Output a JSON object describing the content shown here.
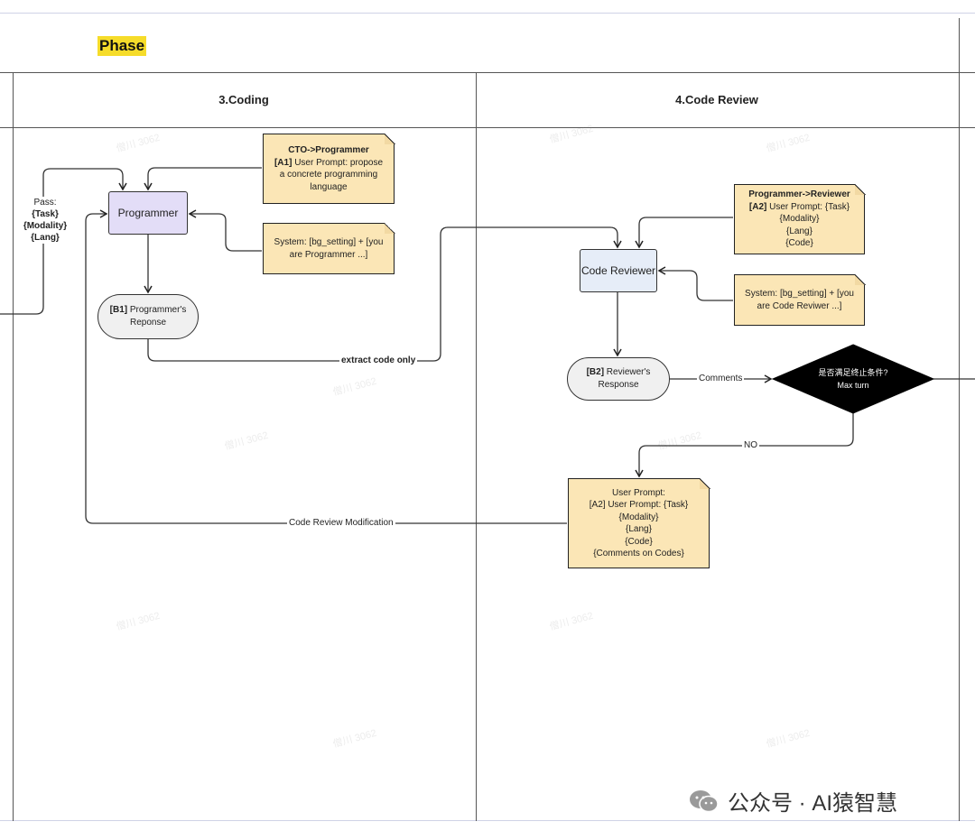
{
  "phase_label": "Phase",
  "columns": [
    {
      "title": "3.Coding"
    },
    {
      "title": "4.Code Review"
    }
  ],
  "pass_note": {
    "line1": "Pass:",
    "line2": "{Task}",
    "line3": "{Modality}",
    "line4": "{Lang}"
  },
  "notes": {
    "cto_programmer": {
      "title": "CTO->Programmer",
      "tag": "[A1]",
      "line1": " User Prompt: propose",
      "line2": "a concrete programming",
      "line3": "language"
    },
    "system_programmer": {
      "line1": "System: [bg_setting] + [you",
      "line2": "are Programmer ...]"
    },
    "programmer_reviewer": {
      "title": "Programmer->Reviewer",
      "tag": "[A2]",
      "line1": " User Prompt: {Task}",
      "line2": "{Modality}",
      "line3": "{Lang}",
      "line4": "{Code}"
    },
    "system_reviewer": {
      "line1": "System: [bg_setting] + [you",
      "line2": "are Code Reviwer ...]"
    },
    "user_prompt_modification": {
      "line1": "User Prompt:",
      "line2": "[A2] User Prompt: {Task}",
      "line3": "{Modality}",
      "line4": "{Lang}",
      "line5": "{Code}",
      "line6": "{Comments on Codes}"
    }
  },
  "nodes": {
    "programmer": "Programmer",
    "code_reviewer": "Code Reviewer",
    "b1_tag": "[B1]",
    "b1_line1": " Programmer's",
    "b1_line2": "Reponse",
    "b2_tag": "[B2]",
    "b2_line1": " Reviewer's",
    "b2_line2": "Response",
    "decision_line1": "是否满足终止条件?",
    "decision_line2": "Max turn"
  },
  "edge_labels": {
    "extract": "extract code only",
    "comments": "Comments",
    "no": "NO",
    "modification": "Code Review Modification"
  },
  "watermark": "僧川 3062",
  "footer": "公众号 · AI猿智慧",
  "colors": {
    "programmer_fill": "#e3ddf7",
    "reviewer_fill": "#e6edf8",
    "note_fill": "#fbe6b6",
    "phase_highlight": "#f6dc2a",
    "decision_fill": "#000000"
  }
}
